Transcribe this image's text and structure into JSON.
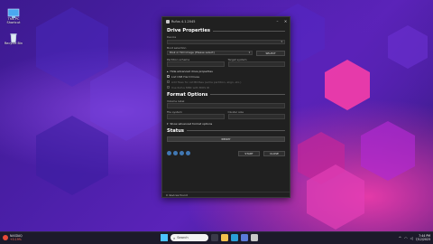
{
  "desktop": {
    "icons": [
      {
        "label_line1": "This PC",
        "label_line2": "Shortcut"
      },
      {
        "label_line1": "Recycle Bin",
        "label_line2": ""
      }
    ]
  },
  "rufus": {
    "title": "Rufus 4.1.2045",
    "drive_properties": {
      "header": "Drive Properties",
      "device_label": "Device",
      "device_value": "",
      "boot_selection_label": "Boot selection",
      "boot_selection_value": "Disk or ISO image (Please select)",
      "select_button": "SELECT",
      "partition_scheme_label": "Partition scheme",
      "partition_scheme_value": "",
      "target_system_label": "Target system",
      "target_system_value": "",
      "advanced_toggle": "Hide advanced drive properties",
      "options": [
        {
          "label": "List USB Hard Drives",
          "enabled": true
        },
        {
          "label": "Add fixes for old BIOSes (extra partition, align, etc.)",
          "enabled": false
        },
        {
          "label": "Use Rufus MBR with BIOS ID",
          "enabled": false
        }
      ]
    },
    "format_options": {
      "header": "Format Options",
      "volume_label_label": "Volume label",
      "volume_label_value": "",
      "file_system_label": "File system",
      "file_system_value": "",
      "cluster_size_label": "Cluster size",
      "cluster_size_value": "",
      "advanced_toggle": "Show advanced format options"
    },
    "status": {
      "header": "Status",
      "value": "READY"
    },
    "buttons": {
      "start": "START",
      "close": "CLOSE"
    },
    "status_line": "0 devices found"
  },
  "taskbar": {
    "weather_temp": "NASDAQ",
    "weather_desc": "+0.19%",
    "search_placeholder": "Search",
    "time": "7:44 PM",
    "date": "7/12/2023",
    "colors": {
      "win_logo": "#4cc2ff",
      "weather_badge": "#e84a3a"
    }
  }
}
